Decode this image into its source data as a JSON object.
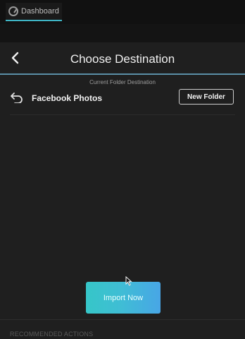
{
  "topbar": {
    "tab_label": "Dashboard",
    "tab_icon": "gauge-icon",
    "accent": "#3fb6c6"
  },
  "panel": {
    "title": "Choose Destination",
    "back_icon": "chevron-left-icon",
    "header_rule_color": "#5b8fa6"
  },
  "folder": {
    "caption": "Current Folder Destination",
    "name": "Facebook Photos",
    "back_icon": "undo-arrow-icon",
    "new_folder_label": "New Folder"
  },
  "actions": {
    "import_label": "Import Now",
    "import_gradient": [
      "#36c6c8",
      "#48a6e6"
    ]
  },
  "footer": {
    "recommended_label": "RECOMMENDED ACTIONS"
  }
}
